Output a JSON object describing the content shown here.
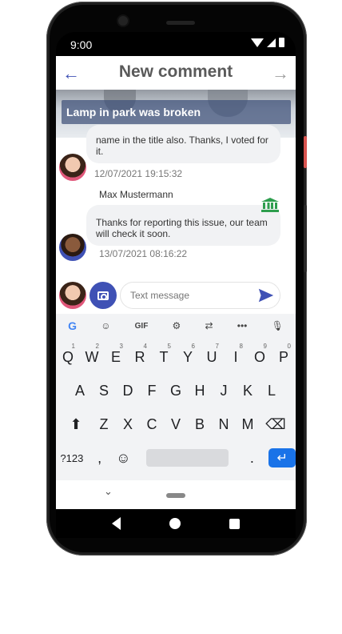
{
  "status": {
    "time": "9:00"
  },
  "appbar": {
    "title": "New comment",
    "back_icon": "arrow-left-icon",
    "forward_icon": "arrow-right-icon"
  },
  "issue": {
    "title": "Lamp in park was broken"
  },
  "messages": [
    {
      "text": "name in the title also. Thanks, I voted for it.",
      "time": "12/07/2021 19:15:32"
    },
    {
      "author": "Max Mustermann",
      "text": "Thanks for reporting this issue, our team will check it soon.",
      "time": "13/07/2021 08:16:22"
    }
  ],
  "composer": {
    "placeholder": "Text message"
  },
  "keyboard": {
    "toolbar": [
      "G",
      "sticker",
      "GIF",
      "settings",
      "translate",
      "more",
      "mic"
    ],
    "row1": [
      "Q",
      "W",
      "E",
      "R",
      "T",
      "Y",
      "U",
      "I",
      "O",
      "P"
    ],
    "row1_hints": [
      "1",
      "2",
      "3",
      "4",
      "5",
      "6",
      "7",
      "8",
      "9",
      "0"
    ],
    "row2": [
      "A",
      "S",
      "D",
      "F",
      "G",
      "H",
      "J",
      "K",
      "L"
    ],
    "row3": [
      "Z",
      "X",
      "C",
      "V",
      "B",
      "N",
      "M"
    ],
    "sym_key": "?123",
    "comma": ",",
    "period": "."
  },
  "colors": {
    "accent": "#3f51b5",
    "gov_green": "#2e9e4e"
  }
}
